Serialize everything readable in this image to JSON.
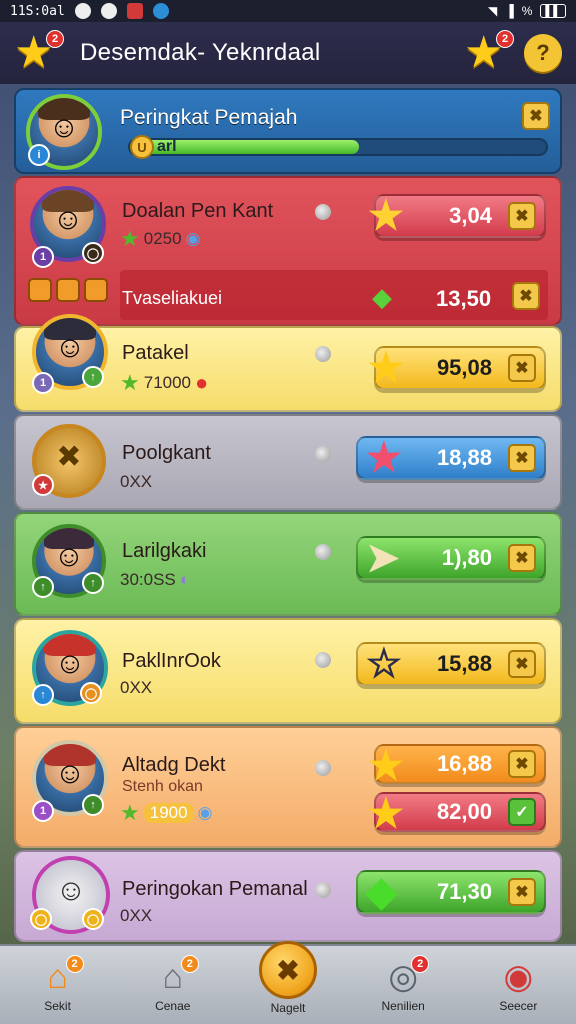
{
  "status_bar": {
    "time": "11S:0al",
    "signal": "%"
  },
  "header": {
    "title": "Desemdak- Yeknrdaal",
    "notif_count": "2",
    "help_icon": "?"
  },
  "player": {
    "title": "Peringkat Pemajah",
    "level_label": "arl",
    "xp_progress": 0.55
  },
  "rows": [
    {
      "name": "Doalan Pen Kant",
      "sub": "0250",
      "value": "3,04",
      "color": "red",
      "icon": "sword-icon"
    },
    {
      "name": "Tvaseliakuei",
      "value": "13,50",
      "color": "red",
      "icon": "green-gem-icon"
    },
    {
      "name": "Patakel",
      "sub": "71000",
      "value": "95,08",
      "color": "yellow",
      "icon": "star-icon"
    },
    {
      "name": "Poolgkant",
      "sub": "0XX",
      "value": "18,88",
      "color": "blue",
      "icon": "red-star-icon"
    },
    {
      "name": "Larilgkaki",
      "sub": "30:0SS",
      "value": "1),80",
      "color": "green",
      "icon": "plane-icon"
    },
    {
      "name": "PaklInrOok",
      "sub": "0XX",
      "value": "15,88",
      "color": "yellow",
      "icon": "outline-star-icon"
    },
    {
      "name": "Altadg Dekt",
      "sub_title": "Stenh okan",
      "sub": "1900",
      "value": "16,88",
      "value2": "82,00",
      "color": "orange",
      "icon": "star-icon"
    },
    {
      "name": "Peringokan Pemanal",
      "sub": "0XX",
      "value": "71,30",
      "color": "green",
      "icon": "gem-icon"
    }
  ],
  "nav": [
    {
      "label": "Sekit",
      "icon": "home-icon",
      "badge": "2"
    },
    {
      "label": "Cenae",
      "icon": "shop-icon",
      "badge": "2"
    },
    {
      "label": "Nagelt",
      "icon": "battle-icon",
      "badge": ""
    },
    {
      "label": "Nenilien",
      "icon": "target-icon",
      "badge": "2"
    },
    {
      "label": "Seecer",
      "icon": "settings-icon",
      "badge": ""
    }
  ]
}
